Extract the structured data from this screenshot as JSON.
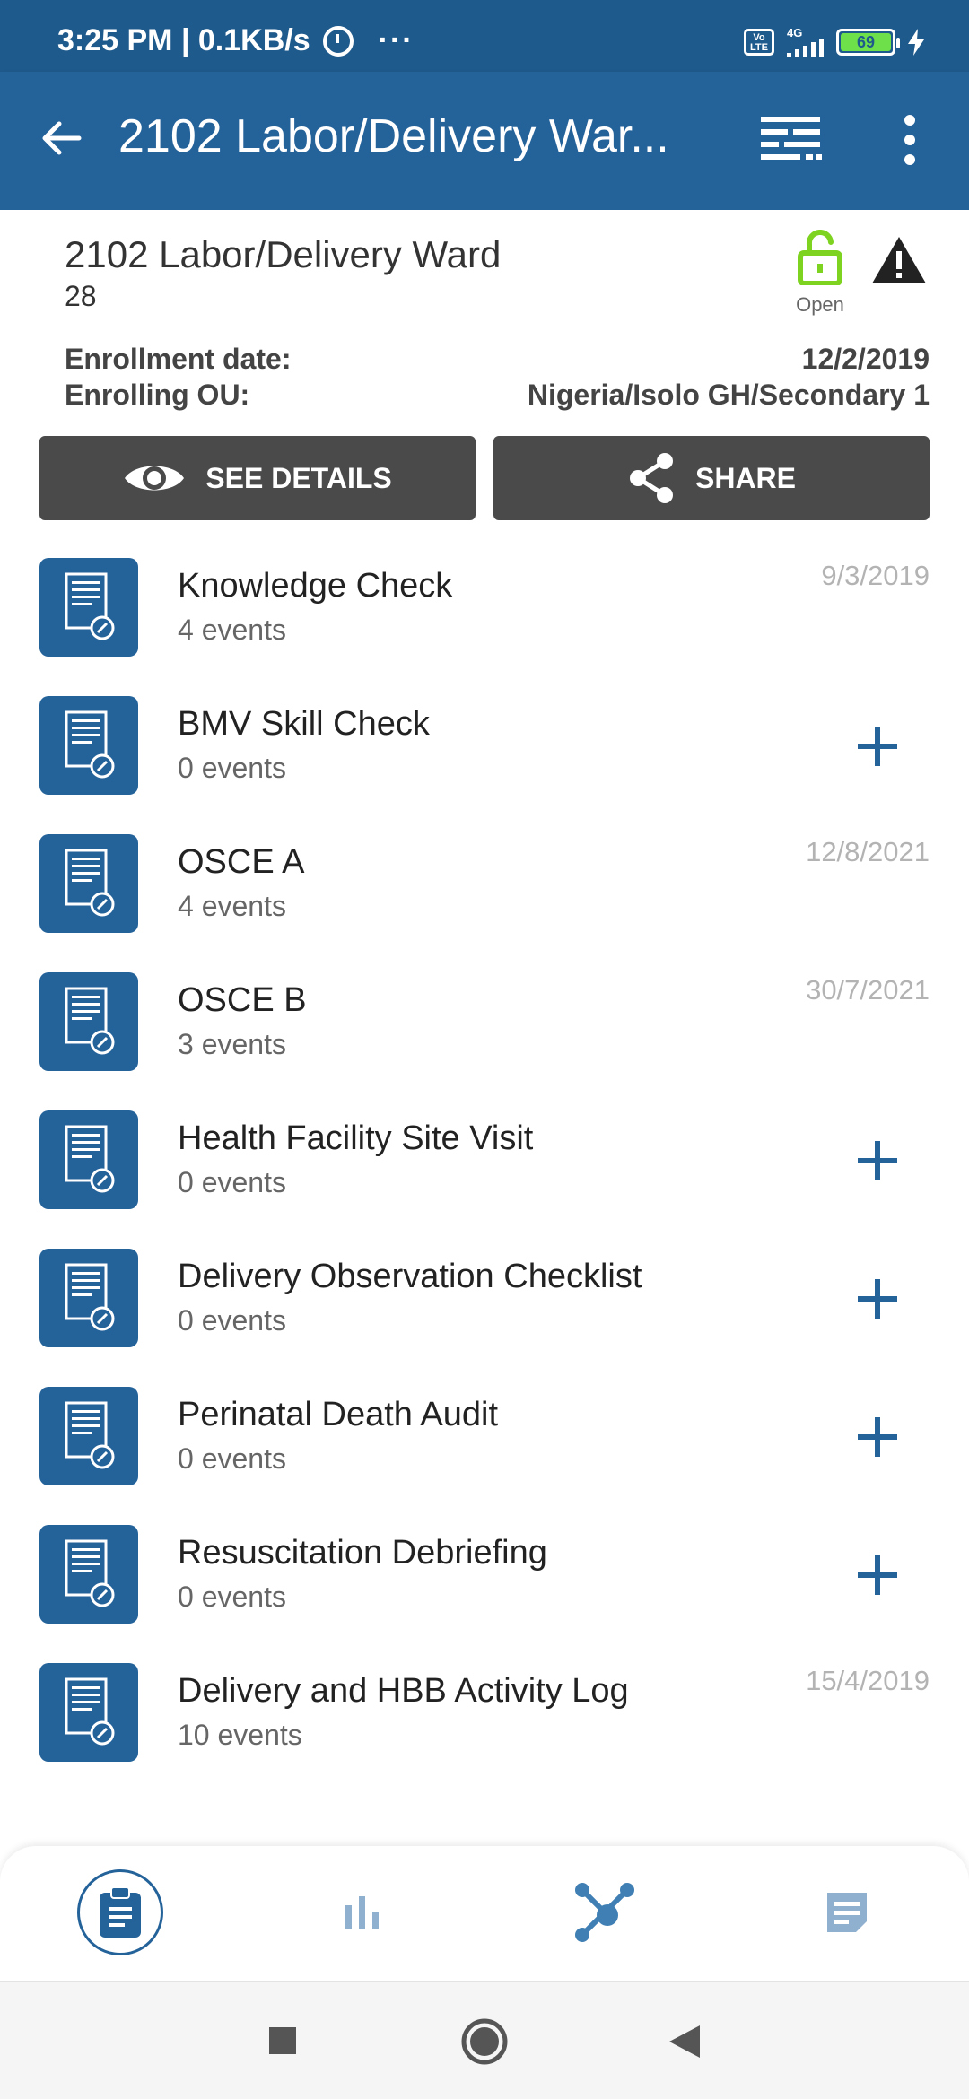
{
  "status_bar": {
    "time": "3:25 PM | 0.1KB/s",
    "dots": "···",
    "volte": "Vo LTE",
    "network": "4G",
    "battery": "69"
  },
  "app_bar": {
    "title": "2102 Labor/Delivery War..."
  },
  "header": {
    "title": "2102 Labor/Delivery Ward",
    "subtitle": "28",
    "status_label": "Open",
    "enrollment_date_label": "Enrollment date:",
    "enrollment_date_value": "12/2/2019",
    "enrolling_ou_label": "Enrolling OU:",
    "enrolling_ou_value": "Nigeria/Isolo GH/Secondary 1",
    "see_details_label": "SEE DETAILS",
    "share_label": "SHARE"
  },
  "stages": [
    {
      "name": "Knowledge Check",
      "events": "4 events",
      "date": "9/3/2019",
      "addable": false
    },
    {
      "name": "BMV Skill Check",
      "events": "0 events",
      "date": "",
      "addable": true
    },
    {
      "name": "OSCE A",
      "events": "4 events",
      "date": "12/8/2021",
      "addable": false
    },
    {
      "name": "OSCE B",
      "events": "3 events",
      "date": "30/7/2021",
      "addable": false
    },
    {
      "name": "Health Facility Site Visit",
      "events": "0 events",
      "date": "",
      "addable": true
    },
    {
      "name": "Delivery Observation Checklist",
      "events": "0 events",
      "date": "",
      "addable": true
    },
    {
      "name": "Perinatal Death Audit",
      "events": "0 events",
      "date": "",
      "addable": true
    },
    {
      "name": "Resuscitation Debriefing",
      "events": "0 events",
      "date": "",
      "addable": true
    },
    {
      "name": "Delivery and HBB Activity Log",
      "events": "10 events",
      "date": "15/4/2019",
      "addable": false
    }
  ],
  "colors": {
    "primary": "#24629a",
    "status_bar": "#1f5a8c",
    "button_dark": "#4a4a4a",
    "open_green": "#7ed321",
    "nav_inactive": "#8fb0cf"
  },
  "icons": {
    "back": "arrow-left-icon",
    "filter": "filter-icon",
    "more": "more-vert-icon",
    "lock": "unlock-icon",
    "warning": "warning-icon",
    "eye": "eye-icon",
    "share": "share-icon",
    "stage": "form-icon",
    "add": "plus-icon"
  }
}
